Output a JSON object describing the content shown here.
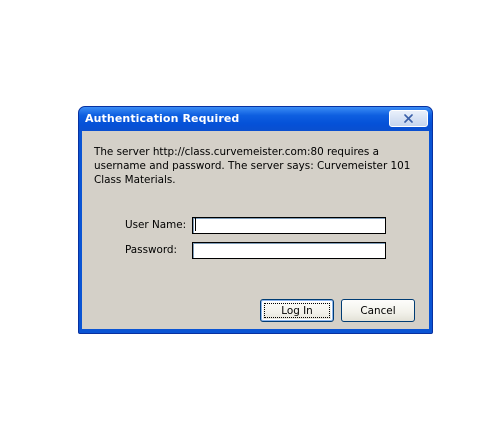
{
  "dialog": {
    "title": "Authentication Required",
    "message": "The server http://class.curvemeister.com:80 requires a username and password. The server says: Curvemeister 101 Class Materials."
  },
  "form": {
    "username_label": "User Name:",
    "username_value": "",
    "password_label": "Password:",
    "password_value": ""
  },
  "buttons": {
    "login_label": "Log In",
    "cancel_label": "Cancel"
  },
  "icons": {
    "close": "close-icon"
  },
  "colors": {
    "titlebar": "#0a54d4",
    "client": "#d4d0c8"
  }
}
